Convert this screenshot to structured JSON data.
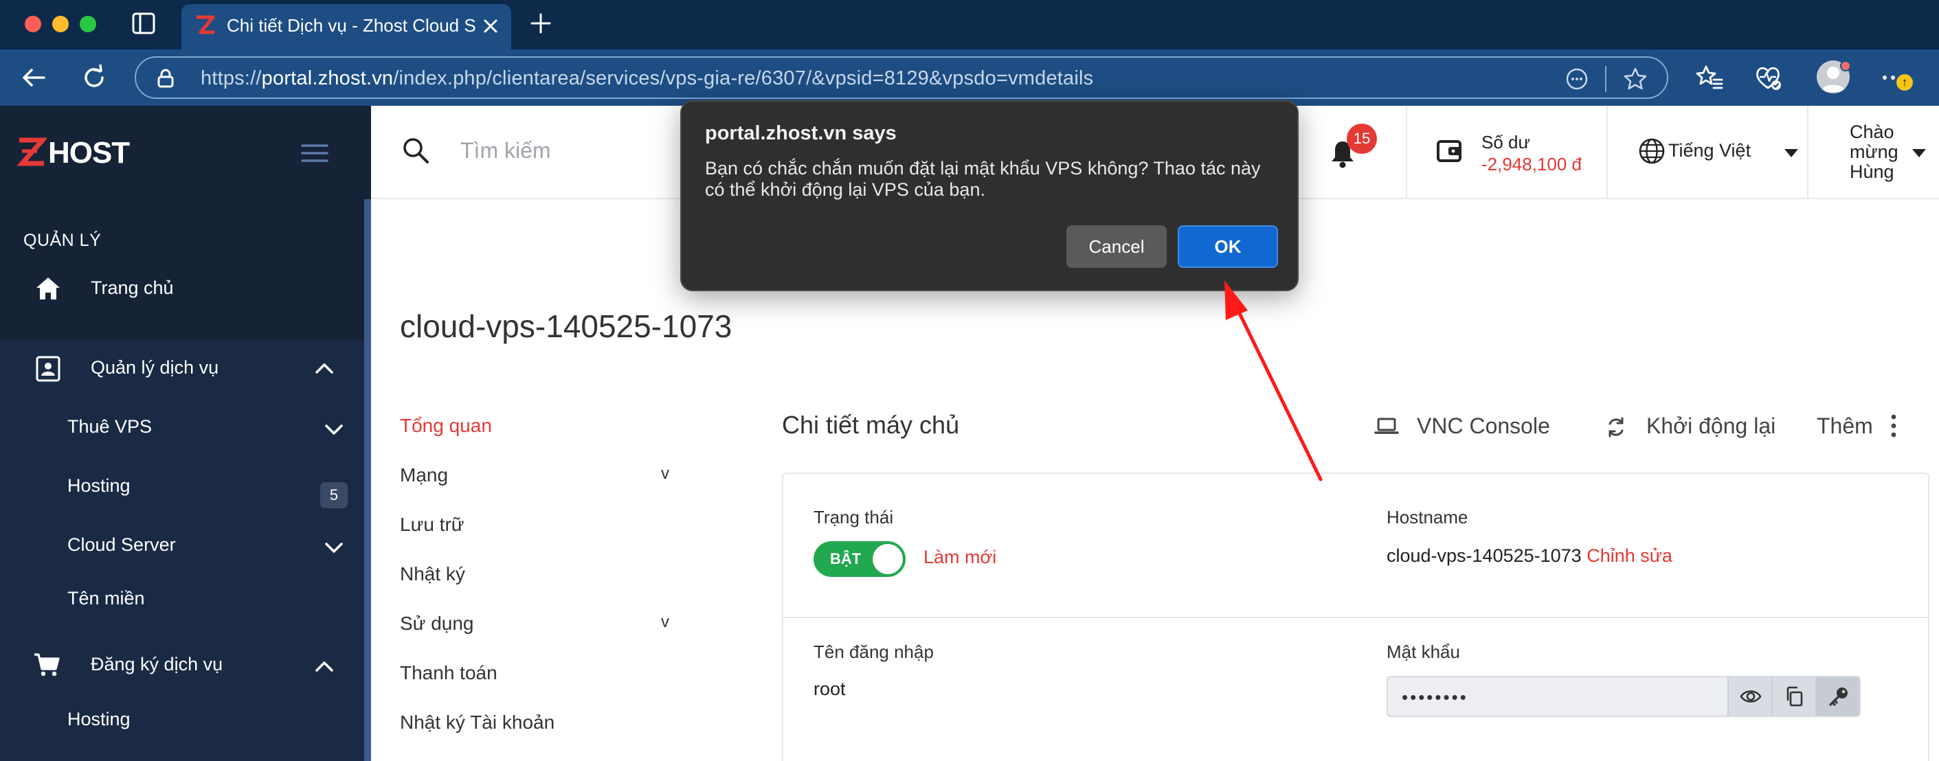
{
  "browser": {
    "tab_title": "Chi tiết Dịch vụ - Zhost Cloud S",
    "url_scheme": "https://",
    "url_host": "portal.zhost.vn",
    "url_path": "/index.php/clientarea/services/vps-gia-re/6307/&vpsid=8129&vpsdo=vmdetails"
  },
  "sidebar": {
    "logo": "HOST",
    "section_manage": "QUẢN LÝ",
    "home": "Trang chủ",
    "service_mgmt": "Quản lý dịch vụ",
    "items": [
      {
        "label": "Thuê VPS"
      },
      {
        "label": "Hosting"
      },
      {
        "label": "Cloud Server"
      },
      {
        "label": "Tên miền",
        "badge": "5"
      }
    ],
    "register": "Đăng ký dịch vụ",
    "register_items": [
      {
        "label": "Hosting"
      }
    ]
  },
  "header": {
    "search_placeholder": "Tìm kiếm",
    "notifications": "15",
    "balance_label": "Số dư",
    "balance_value": "-2,948,100 đ",
    "language": "Tiếng Việt",
    "greeting": "Chào mừng Hùng"
  },
  "vps": {
    "title": "cloud-vps-140525-1073",
    "subnav": [
      {
        "label": "Tổng quan",
        "active": true
      },
      {
        "label": "Mạng",
        "expand": "v"
      },
      {
        "label": "Lưu trữ"
      },
      {
        "label": "Nhật ký"
      },
      {
        "label": "Sử dụng",
        "expand": "v"
      },
      {
        "label": "Thanh toán"
      },
      {
        "label": "Nhật ký Tài khoản"
      }
    ],
    "section_title": "Chi tiết máy chủ",
    "actions": {
      "vnc": "VNC Console",
      "reboot": "Khởi động lại",
      "more": "Thêm"
    },
    "status_label": "Trạng thái",
    "status_toggle": "BẬT",
    "refresh": "Làm mới",
    "hostname_label": "Hostname",
    "hostname": "cloud-vps-140525-1073",
    "edit": "Chỉnh sửa",
    "username_label": "Tên đăng nhập",
    "username": "root",
    "password_label": "Mật khẩu",
    "password_masked": "••••••••"
  },
  "dialog": {
    "title": "portal.zhost.vn says",
    "message": "Bạn có chắc chắn muốn đặt lại mật khẩu VPS không? Thao tác này có thể khởi động lại VPS của bạn.",
    "cancel": "Cancel",
    "ok": "OK"
  },
  "colors": {
    "accent_red": "#e53935",
    "sidebar_bg": "#1a2a44",
    "ok_blue": "#1068d0",
    "toggle_green": "#22a84f"
  }
}
